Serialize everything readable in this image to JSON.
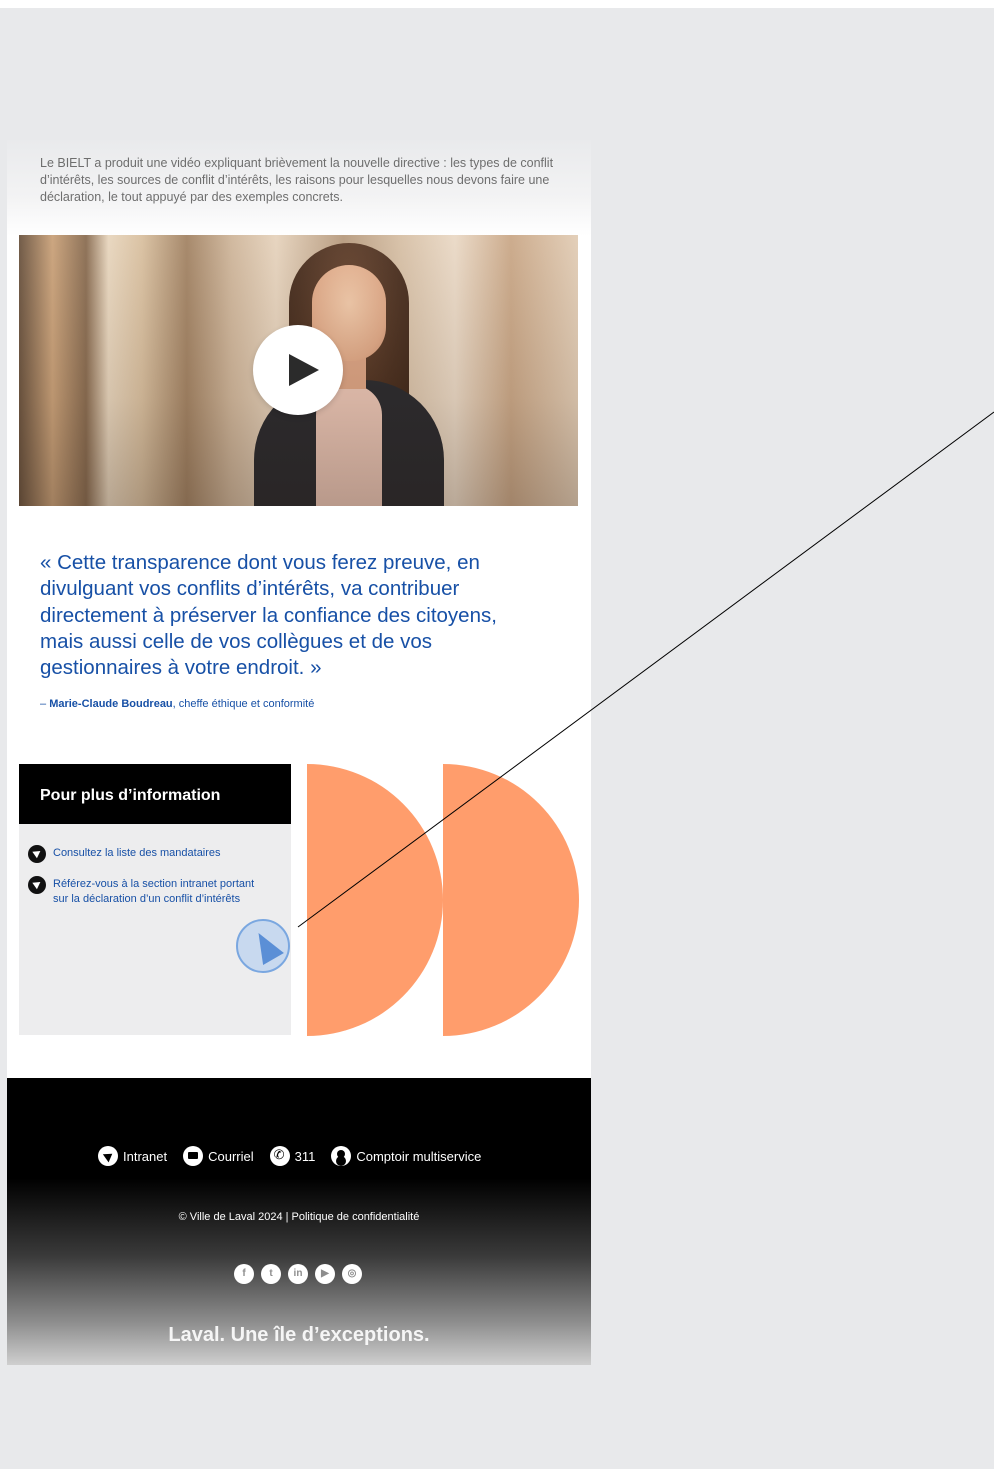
{
  "intro": {
    "text": "Le BIELT a produit une vidéo expliquant brièvement la nouvelle directive : les types de conflit d’intérêts, les sources de conflit d’intérêts, les raisons pour lesquelles nous devons faire une déclaration, le tout appuyé par des exemples concrets."
  },
  "video": {
    "play_icon": "play-icon"
  },
  "quote": {
    "text": "« Cette transparence dont vous ferez preuve, en divulguant vos conflits d’intérêts, va contribuer directement à préserver la confiance des citoyens, mais aussi celle de vos collègues et de vos gestionnaires à votre endroit. »",
    "dash": "– ",
    "author": "Marie-Claude Boudreau",
    "role": ", cheffe éthique et conformité"
  },
  "info": {
    "title": "Pour plus d’information",
    "links": [
      "Consultez la liste des mandataires",
      "Référez-vous à la section intranet portant sur la déclaration d’un conflit d’intérêts"
    ]
  },
  "footer": {
    "nav": [
      {
        "label": "Intranet",
        "icon": "cursor-icon"
      },
      {
        "label": "Courriel",
        "icon": "mail-icon"
      },
      {
        "label": "311",
        "icon": "phone-icon"
      },
      {
        "label": "Comptoir multiservice",
        "icon": "user-icon"
      }
    ],
    "copyright": "© Ville de Laval 2024 | Politique de confidentialité",
    "socials": [
      {
        "icon": "facebook-icon",
        "glyph": "f"
      },
      {
        "icon": "twitter-icon",
        "glyph": "t"
      },
      {
        "icon": "linkedin-icon",
        "glyph": "in"
      },
      {
        "icon": "youtube-icon",
        "glyph": "▶"
      },
      {
        "icon": "instagram-icon",
        "glyph": "◎"
      }
    ],
    "tagline": "Laval. Une île d’exceptions."
  },
  "colors": {
    "accent_blue": "#1750a6",
    "deco_orange": "#ff9d6c",
    "page_bg": "#e8e9eb"
  }
}
